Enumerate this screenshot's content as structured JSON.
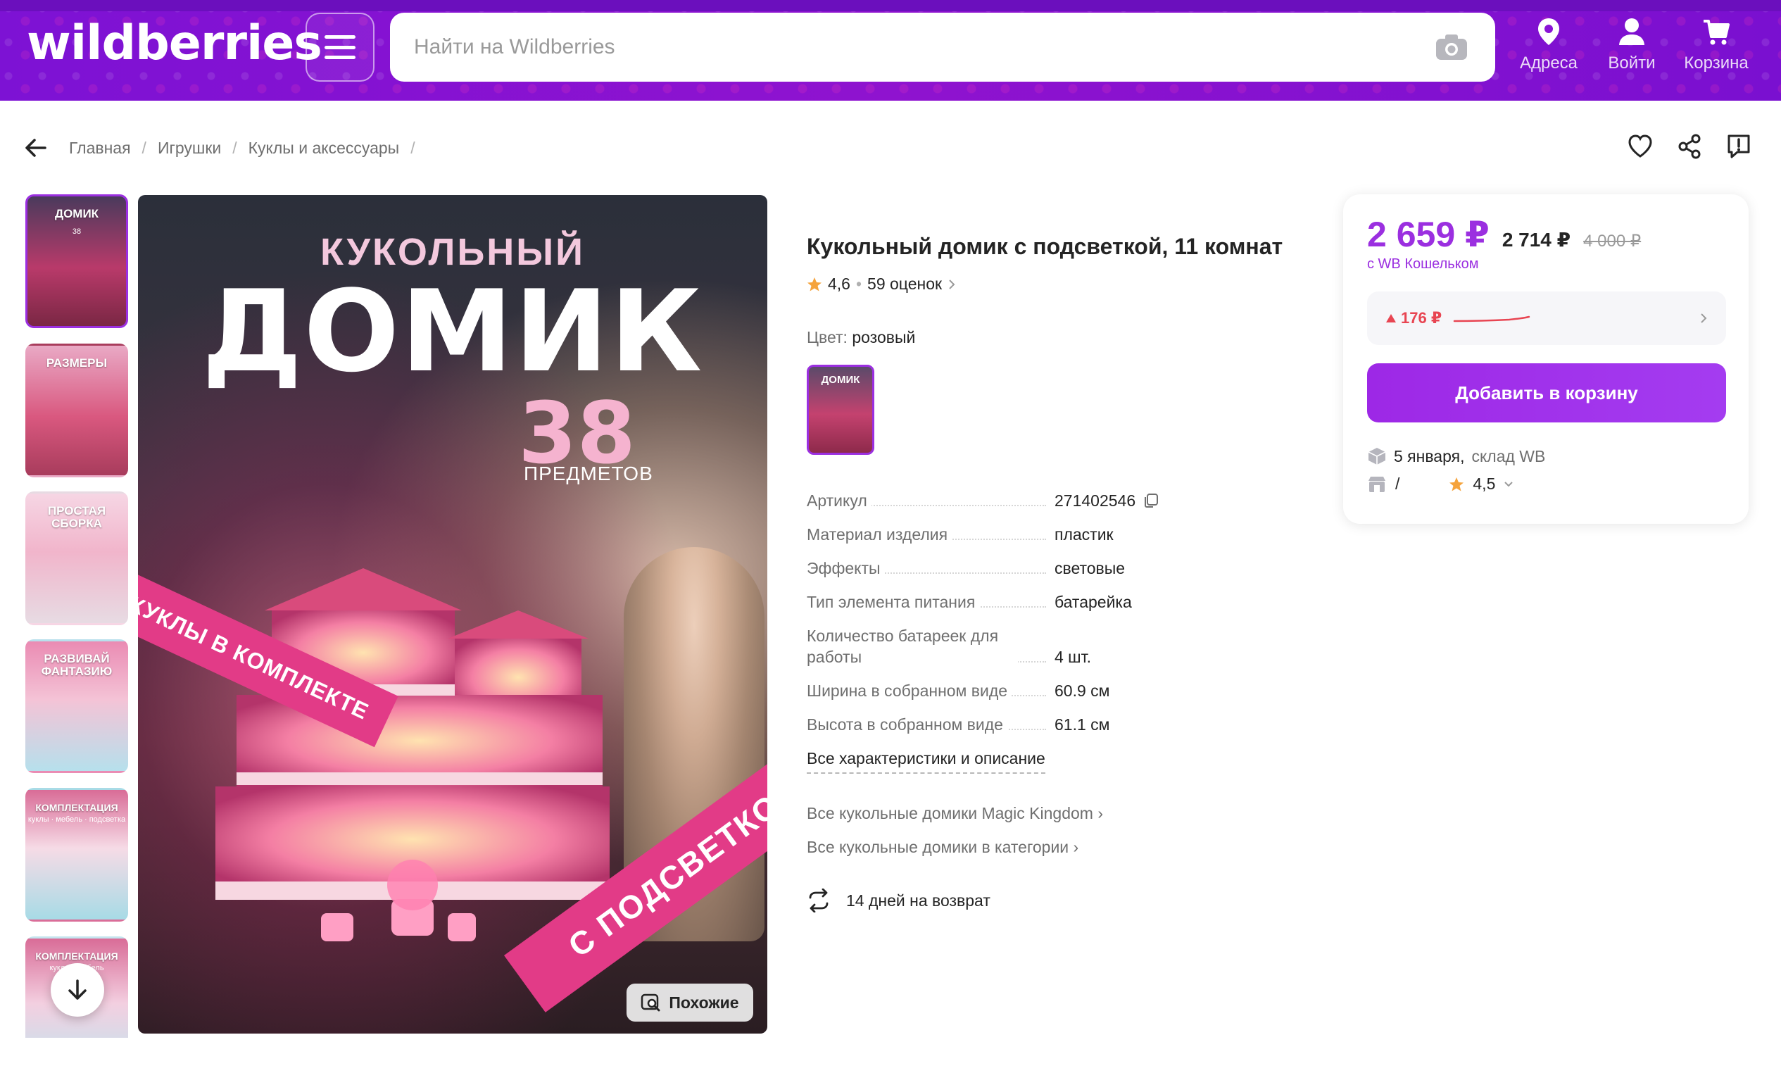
{
  "header": {
    "logo": "wildberries",
    "search_placeholder": "Найти на Wildberries",
    "actions": [
      {
        "label": "Адреса",
        "icon": "location-pin-icon"
      },
      {
        "label": "Войти",
        "icon": "user-icon"
      },
      {
        "label": "Корзина",
        "icon": "cart-icon"
      }
    ],
    "brand_color": "#8a12d6"
  },
  "breadcrumbs": [
    "Главная",
    "Игрушки",
    "Куклы и аксессуары"
  ],
  "gallery": {
    "thumbnails": [
      {
        "label": "ДОМИК",
        "sub": "38"
      },
      {
        "label": "РАЗМЕРЫ",
        "sub": ""
      },
      {
        "label": "ПРОСТАЯ СБОРКА",
        "sub": ""
      },
      {
        "label": "РАЗВИВАЙ ФАНТАЗИЮ",
        "sub": ""
      },
      {
        "label": "КОМПЛЕКТАЦИЯ",
        "sub": "куклы · мебель · подсветка"
      },
      {
        "label": "КОМПЛЕКТАЦИЯ",
        "sub": "куклы · мебель"
      }
    ],
    "main": {
      "line1": "КУКОЛЬНЫЙ",
      "line2": "ДОМИК",
      "number": "38",
      "number_sub": "ПРЕДМЕТОВ",
      "ribbon1": "КУКЛЫ В КОМПЛЕКТЕ",
      "ribbon2": "С ПОДСВЕТКОЙ"
    },
    "similar_label": "Похожие"
  },
  "product": {
    "title": "Кукольный домик с подсветкой, 11 комнат",
    "rating": "4,6",
    "reviews": "59 оценок",
    "color_label": "Цвет:",
    "color_value": "розовый",
    "swatch_label": "ДОМИК",
    "specs": [
      {
        "key": "Артикул",
        "value": "271402546"
      },
      {
        "key": "Материал изделия",
        "value": "пластик"
      },
      {
        "key": "Эффекты",
        "value": "световые"
      },
      {
        "key": "Тип элемента питания",
        "value": "батарейка"
      },
      {
        "key": "Количество батареек для работы",
        "value": "4 шт."
      },
      {
        "key": "Ширина в собранном виде",
        "value": "60.9 см"
      },
      {
        "key": "Высота в собранном виде",
        "value": "61.1 см"
      }
    ],
    "all_specs_link": "Все характеристики и описание",
    "links": [
      "Все кукольные домики Magic Kingdom",
      "Все кукольные домики в категории"
    ],
    "return_policy": "14 дней на возврат"
  },
  "price_card": {
    "price": "2 659 ₽",
    "price_without_wallet": "2 714 ₽",
    "price_old": "4 000 ₽",
    "price_sub": "с WB Кошельком",
    "price_change": "176 ₽",
    "add_to_cart": "Добавить в корзину",
    "delivery_date": "5 января,",
    "delivery_warehouse": "склад WB",
    "seller_name": "/",
    "seller_rating": "4,5",
    "accent_color": "#9b2fe0"
  }
}
